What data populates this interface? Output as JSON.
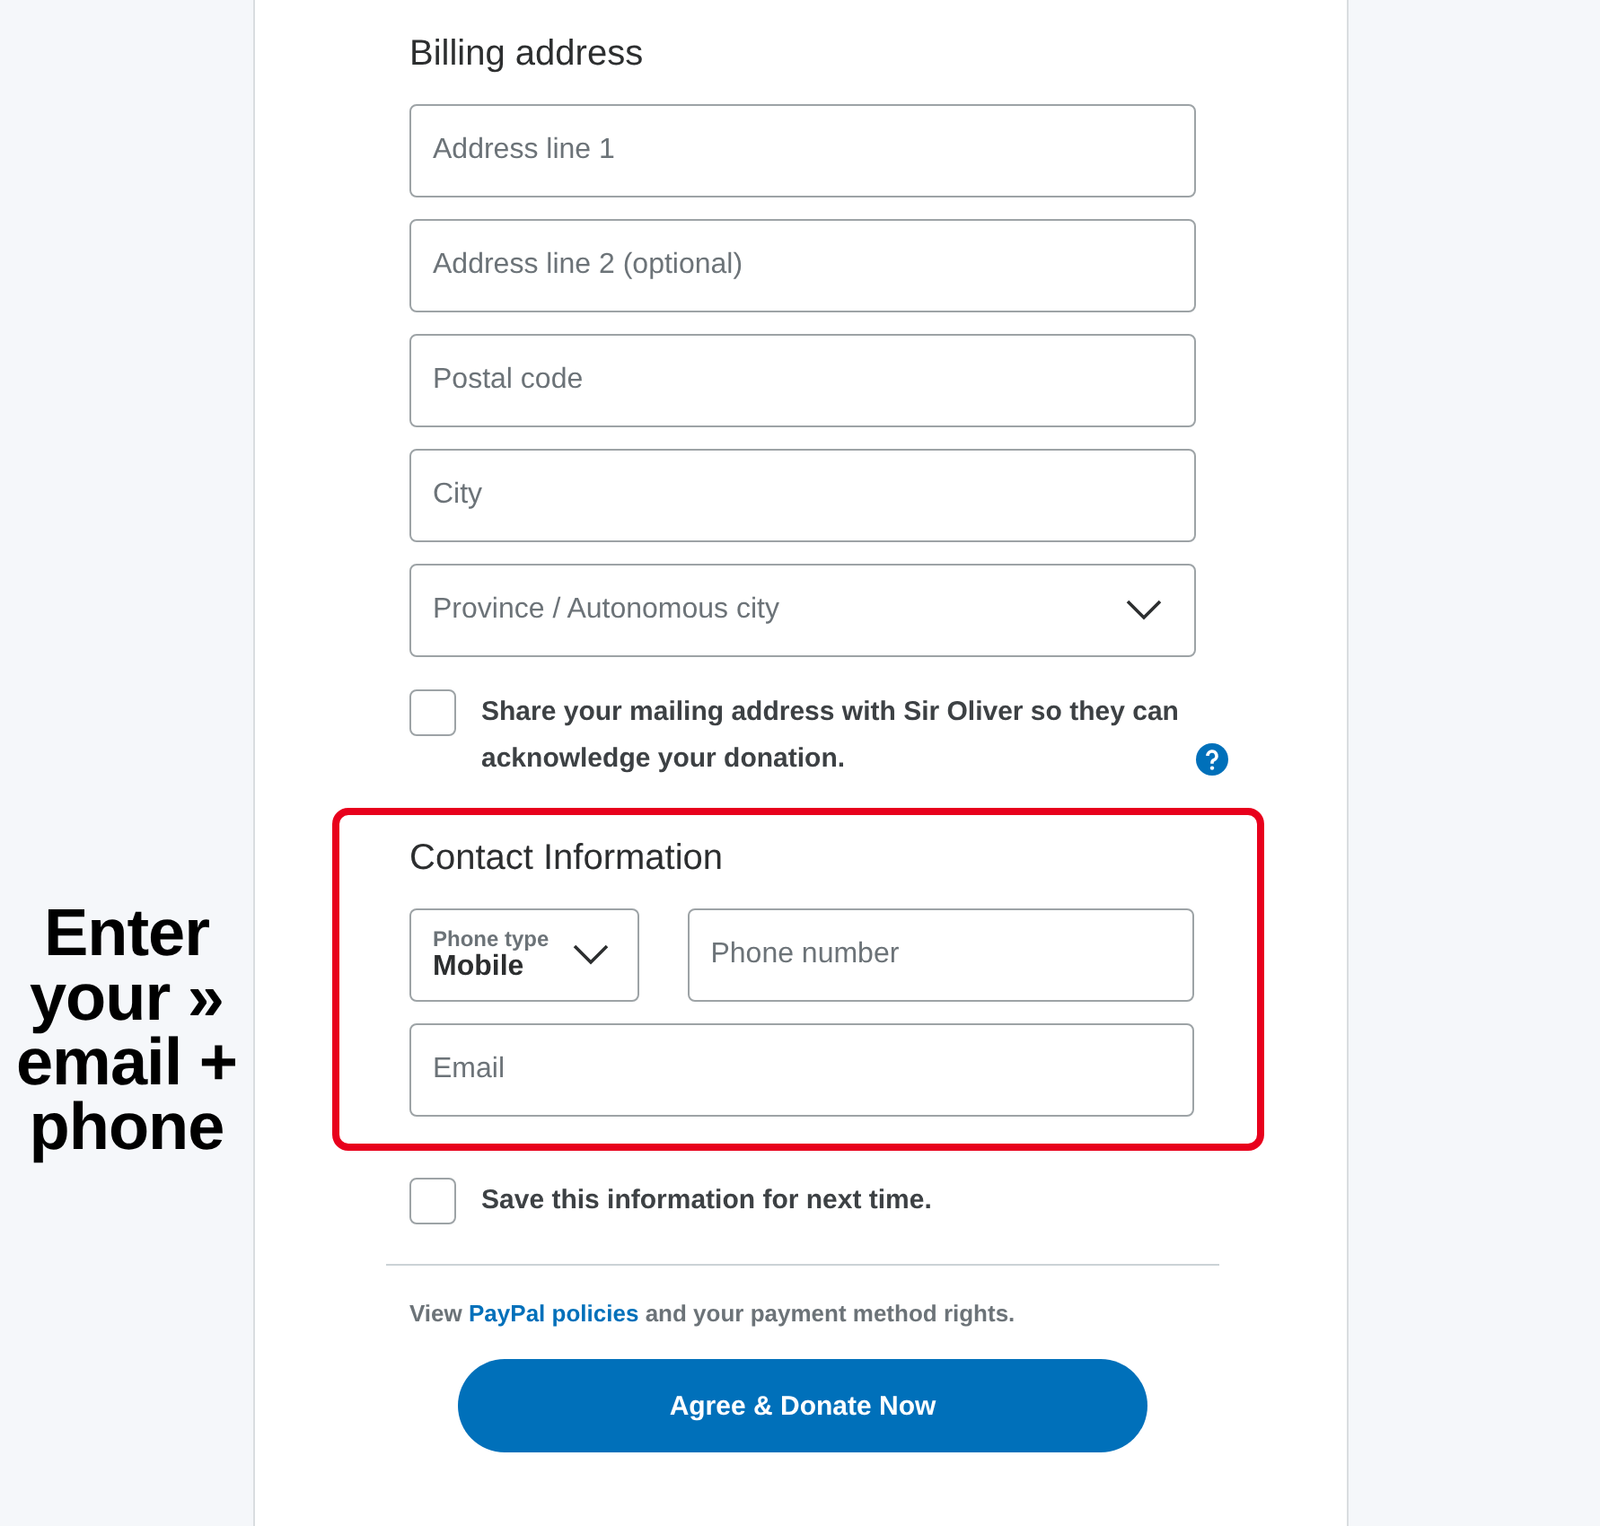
{
  "annotation": {
    "lines": [
      "Enter",
      "your »",
      "email +",
      "phone"
    ]
  },
  "billing": {
    "title": "Billing address",
    "fields": [
      {
        "kind": "text",
        "placeholder": "Address line 1"
      },
      {
        "kind": "text",
        "placeholder": "Address line 2 (optional)"
      },
      {
        "kind": "text",
        "placeholder": "Postal code"
      },
      {
        "kind": "text",
        "placeholder": "City"
      },
      {
        "kind": "select",
        "placeholder": "Province / Autonomous city"
      }
    ],
    "share": {
      "checked": false,
      "text": "Share your mailing address with Sir Oliver so they can acknowledge your donation."
    }
  },
  "contact": {
    "title": "Contact Information",
    "phone_type": {
      "label": "Phone type",
      "value": "Mobile"
    },
    "phone": {
      "placeholder": "Phone number"
    },
    "email": {
      "placeholder": "Email"
    }
  },
  "save": {
    "checked": false,
    "text": "Save this information for next time."
  },
  "policy": {
    "before": "View",
    "link": "PayPal policies",
    "after": "and your payment method rights."
  },
  "button": "Agree & Donate Now"
}
